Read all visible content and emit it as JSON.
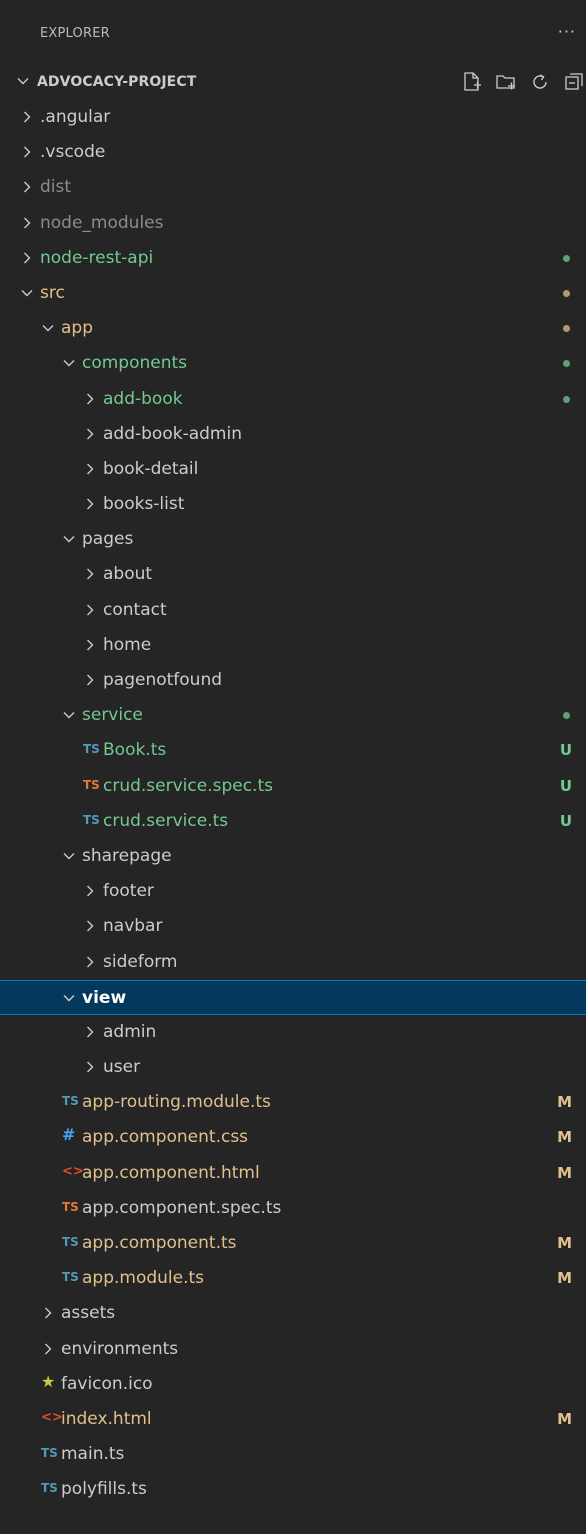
{
  "header": {
    "title": "EXPLORER",
    "more": "···"
  },
  "project": {
    "title": "ADVOCACY-PROJECT"
  },
  "colors": {
    "background": "#252526",
    "selected_bg": "#04395e",
    "selected_border": "#0078d4",
    "untracked_green": "#73c991",
    "modified_orange": "#e2c08d",
    "ts_blue": "#519aba",
    "ts_spec_orange": "#e37933",
    "css_blue": "#42a5f5",
    "html_orange": "#e44d26",
    "favicon_yellow": "#cbcb41",
    "dim": "#8c8c8c"
  },
  "tree": [
    {
      "label": ".angular",
      "depth": 0,
      "kind": "folder",
      "expanded": false,
      "color": "default"
    },
    {
      "label": ".vscode",
      "depth": 0,
      "kind": "folder",
      "expanded": false,
      "color": "default"
    },
    {
      "label": "dist",
      "depth": 0,
      "kind": "folder",
      "expanded": false,
      "color": "dim"
    },
    {
      "label": "node_modules",
      "depth": 0,
      "kind": "folder",
      "expanded": false,
      "color": "dim"
    },
    {
      "label": "node-rest-api",
      "depth": 0,
      "kind": "folder",
      "expanded": false,
      "color": "green",
      "dot": "green"
    },
    {
      "label": "src",
      "depth": 0,
      "kind": "folder",
      "expanded": true,
      "color": "orange",
      "dot": "orange"
    },
    {
      "label": "app",
      "depth": 1,
      "kind": "folder",
      "expanded": true,
      "color": "orange",
      "dot": "orange"
    },
    {
      "label": "components",
      "depth": 2,
      "kind": "folder",
      "expanded": true,
      "color": "green",
      "dot": "green"
    },
    {
      "label": "add-book",
      "depth": 3,
      "kind": "folder",
      "expanded": false,
      "color": "green",
      "dot": "green"
    },
    {
      "label": "add-book-admin",
      "depth": 3,
      "kind": "folder",
      "expanded": false,
      "color": "default"
    },
    {
      "label": "book-detail",
      "depth": 3,
      "kind": "folder",
      "expanded": false,
      "color": "default"
    },
    {
      "label": "books-list",
      "depth": 3,
      "kind": "folder",
      "expanded": false,
      "color": "default"
    },
    {
      "label": "pages",
      "depth": 2,
      "kind": "folder",
      "expanded": true,
      "color": "default"
    },
    {
      "label": "about",
      "depth": 3,
      "kind": "folder",
      "expanded": false,
      "color": "default"
    },
    {
      "label": "contact",
      "depth": 3,
      "kind": "folder",
      "expanded": false,
      "color": "default"
    },
    {
      "label": "home",
      "depth": 3,
      "kind": "folder",
      "expanded": false,
      "color": "default"
    },
    {
      "label": "pagenotfound",
      "depth": 3,
      "kind": "folder",
      "expanded": false,
      "color": "default"
    },
    {
      "label": "service",
      "depth": 2,
      "kind": "folder",
      "expanded": true,
      "color": "green",
      "dot": "green"
    },
    {
      "label": "Book.ts",
      "depth": 3,
      "kind": "file",
      "icon": "TS",
      "icon_color": "ts",
      "color": "green",
      "letter": "U",
      "letter_color": "green"
    },
    {
      "label": "crud.service.spec.ts",
      "depth": 3,
      "kind": "file",
      "icon": "TS",
      "icon_color": "ts_spec",
      "color": "green",
      "letter": "U",
      "letter_color": "green"
    },
    {
      "label": "crud.service.ts",
      "depth": 3,
      "kind": "file",
      "icon": "TS",
      "icon_color": "ts",
      "color": "green",
      "letter": "U",
      "letter_color": "green"
    },
    {
      "label": "sharepage",
      "depth": 2,
      "kind": "folder",
      "expanded": true,
      "color": "default"
    },
    {
      "label": "footer",
      "depth": 3,
      "kind": "folder",
      "expanded": false,
      "color": "default"
    },
    {
      "label": "navbar",
      "depth": 3,
      "kind": "folder",
      "expanded": false,
      "color": "default"
    },
    {
      "label": "sideform",
      "depth": 3,
      "kind": "folder",
      "expanded": false,
      "color": "default"
    },
    {
      "label": "view",
      "depth": 2,
      "kind": "folder",
      "expanded": true,
      "color": "white",
      "selected": true
    },
    {
      "label": "admin",
      "depth": 3,
      "kind": "folder",
      "expanded": false,
      "color": "default"
    },
    {
      "label": "user",
      "depth": 3,
      "kind": "folder",
      "expanded": false,
      "color": "default"
    },
    {
      "label": "app-routing.module.ts",
      "depth": 2,
      "kind": "file",
      "icon": "TS",
      "icon_color": "ts",
      "color": "orange",
      "letter": "M",
      "letter_color": "orange"
    },
    {
      "label": "app.component.css",
      "depth": 2,
      "kind": "file",
      "icon": "#",
      "icon_color": "css",
      "color": "orange",
      "letter": "M",
      "letter_color": "orange"
    },
    {
      "label": "app.component.html",
      "depth": 2,
      "kind": "file",
      "icon": "<>",
      "icon_color": "html",
      "color": "orange",
      "letter": "M",
      "letter_color": "orange"
    },
    {
      "label": "app.component.spec.ts",
      "depth": 2,
      "kind": "file",
      "icon": "TS",
      "icon_color": "ts_spec",
      "color": "default"
    },
    {
      "label": "app.component.ts",
      "depth": 2,
      "kind": "file",
      "icon": "TS",
      "icon_color": "ts",
      "color": "orange",
      "letter": "M",
      "letter_color": "orange"
    },
    {
      "label": "app.module.ts",
      "depth": 2,
      "kind": "file",
      "icon": "TS",
      "icon_color": "ts",
      "color": "orange",
      "letter": "M",
      "letter_color": "orange"
    },
    {
      "label": "assets",
      "depth": 1,
      "kind": "folder",
      "expanded": false,
      "color": "default"
    },
    {
      "label": "environments",
      "depth": 1,
      "kind": "folder",
      "expanded": false,
      "color": "default"
    },
    {
      "label": "favicon.ico",
      "depth": 1,
      "kind": "file",
      "icon": "★",
      "icon_color": "favicon",
      "color": "default"
    },
    {
      "label": "index.html",
      "depth": 1,
      "kind": "file",
      "icon": "<>",
      "icon_color": "html",
      "color": "orange",
      "letter": "M",
      "letter_color": "orange"
    },
    {
      "label": "main.ts",
      "depth": 1,
      "kind": "file",
      "icon": "TS",
      "icon_color": "ts",
      "color": "default"
    },
    {
      "label": "polyfills.ts",
      "depth": 1,
      "kind": "file",
      "icon": "TS",
      "icon_color": "ts",
      "color": "default"
    }
  ]
}
